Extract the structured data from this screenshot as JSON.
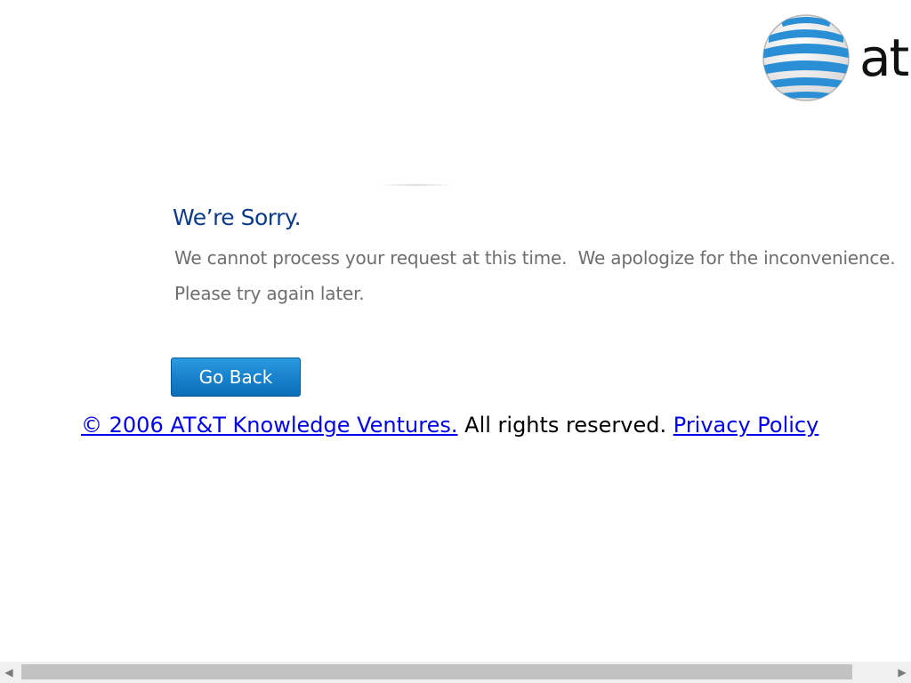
{
  "header": {
    "logo_text": "at&t",
    "logo_icon": "att-globe-icon"
  },
  "error": {
    "title": "We’re Sorry.",
    "message_line1": "We cannot process your request at this time.  We apologize for the inconvenience.",
    "message_line2": "Please try again later."
  },
  "actions": {
    "go_back_label": "Go Back"
  },
  "footer": {
    "copyright_link": "© 2006 AT&T Knowledge Ventures.",
    "rights_text": " All rights reserved. ",
    "privacy_link": "Privacy Policy"
  },
  "scrollbar": {
    "left_arrow": "◀",
    "right_arrow": "▶"
  },
  "colors": {
    "title": "#0d3b8c",
    "message": "#6e6e6e",
    "button": "#1882cc",
    "link": "#0000ee",
    "globe_blue": "#2b8fd6"
  }
}
